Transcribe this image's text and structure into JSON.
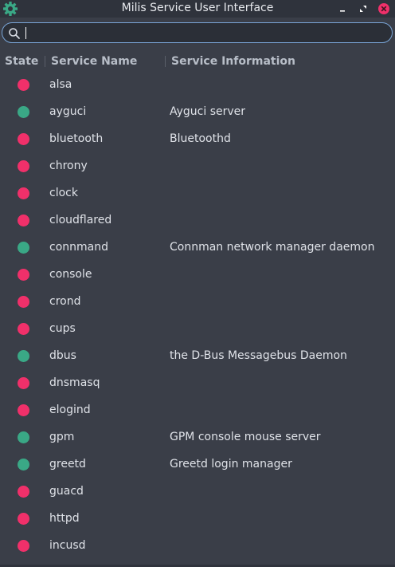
{
  "window": {
    "title": "Milis Service User Interface",
    "icon": "gear-icon",
    "controls": [
      "minimize-icon",
      "maximize-icon",
      "close-icon"
    ]
  },
  "search": {
    "value": "",
    "placeholder": ""
  },
  "table": {
    "headers": [
      "State",
      "Service Name",
      "Service Information"
    ],
    "colors": {
      "stopped": "#f0306a",
      "running": "#3aa886"
    },
    "rows": [
      {
        "state": "stopped",
        "name": "alsa",
        "info": ""
      },
      {
        "state": "running",
        "name": "ayguci",
        "info": "Ayguci server"
      },
      {
        "state": "stopped",
        "name": "bluetooth",
        "info": "Bluetoothd"
      },
      {
        "state": "stopped",
        "name": "chrony",
        "info": ""
      },
      {
        "state": "stopped",
        "name": "clock",
        "info": ""
      },
      {
        "state": "stopped",
        "name": "cloudflared",
        "info": ""
      },
      {
        "state": "running",
        "name": "connmand",
        "info": "Connman network manager daemon"
      },
      {
        "state": "stopped",
        "name": "console",
        "info": ""
      },
      {
        "state": "stopped",
        "name": "crond",
        "info": ""
      },
      {
        "state": "stopped",
        "name": "cups",
        "info": ""
      },
      {
        "state": "running",
        "name": "dbus",
        "info": "the D-Bus Messagebus Daemon"
      },
      {
        "state": "stopped",
        "name": "dnsmasq",
        "info": ""
      },
      {
        "state": "stopped",
        "name": "elogind",
        "info": ""
      },
      {
        "state": "running",
        "name": "gpm",
        "info": "GPM console mouse server"
      },
      {
        "state": "running",
        "name": "greetd",
        "info": "Greetd login manager"
      },
      {
        "state": "stopped",
        "name": "guacd",
        "info": ""
      },
      {
        "state": "stopped",
        "name": "httpd",
        "info": ""
      },
      {
        "state": "stopped",
        "name": "incusd",
        "info": ""
      }
    ]
  }
}
